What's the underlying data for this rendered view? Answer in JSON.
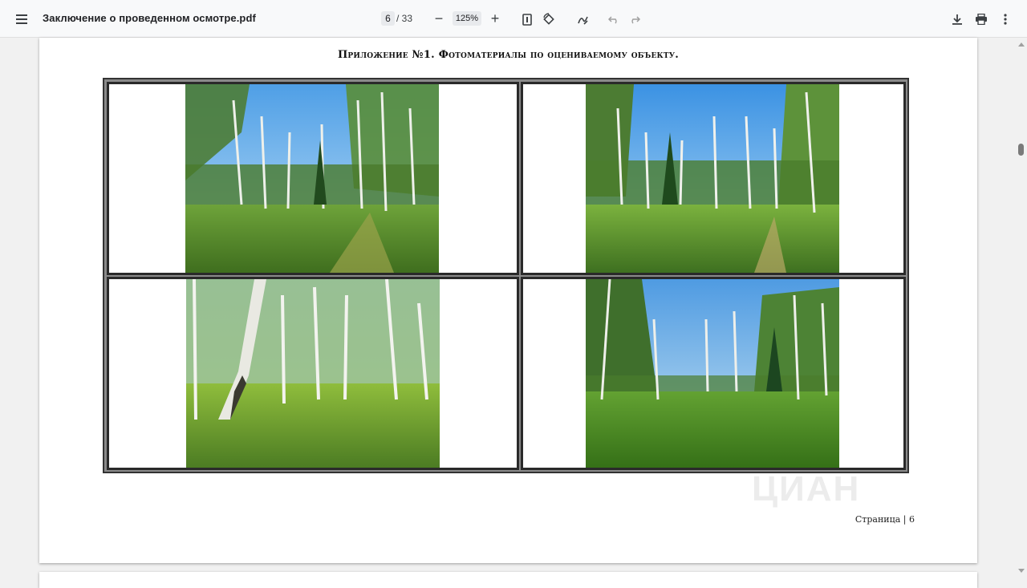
{
  "toolbar": {
    "menu_icon": "hamburger-menu-icon",
    "title": "Заключение о проведенном осмотре.pdf",
    "page_current": "6",
    "page_total": "/ 33",
    "zoom_out": "−",
    "zoom_value": "125%",
    "zoom_in": "+",
    "icons": [
      "fit-page-icon",
      "rotate-icon",
      "annotate-pen-icon",
      "undo-icon",
      "redo-icon",
      "download-icon",
      "print-icon",
      "more-vertical-icon"
    ]
  },
  "page": {
    "heading": "Приложение №1. Фотоматериалы по оцениваемому объекту.",
    "footer_label": "Страница",
    "footer_sep": "|",
    "footer_number": "6",
    "watermark": "ЦИАН",
    "photos": [
      {
        "name": "birch-forest-photo-1"
      },
      {
        "name": "birch-forest-photo-2"
      },
      {
        "name": "birch-forest-photo-3"
      },
      {
        "name": "birch-forest-photo-4"
      }
    ]
  },
  "colors": {
    "toolbar_bg": "#f8f9fa",
    "viewer_bg": "#f1f1f1",
    "table_border": "#2a2a2a",
    "sky": "#5fa9e8",
    "grass": "#5f9a2c"
  }
}
